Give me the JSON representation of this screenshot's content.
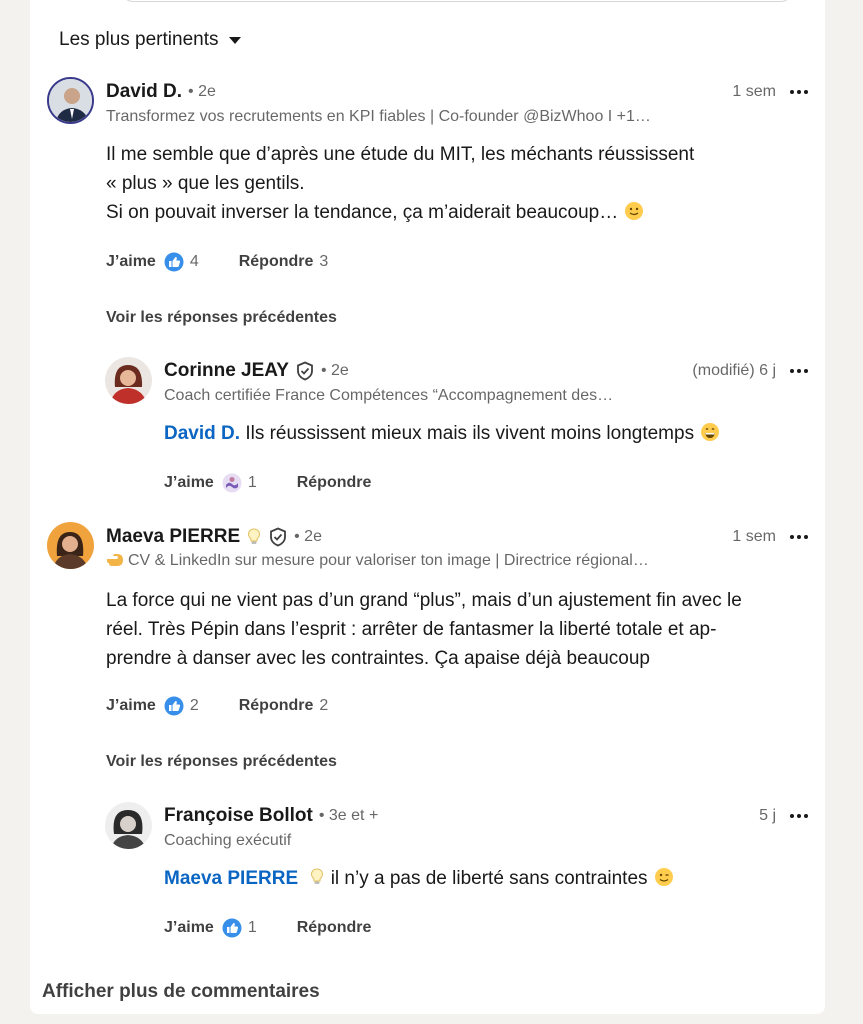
{
  "sort": {
    "label": "Les plus pertinents"
  },
  "comments": [
    {
      "name": "David D.",
      "degree": "• 2e",
      "headline": "Transformez vos recrutements en KPI fiables | Co-founder @BizWhoo I +1…",
      "time": "1 sem",
      "lines": [
        "Il me semble que d’après une étude du MIT, les méchants réussissent",
        "« plus » que les gentils.",
        "Si on pouvait inverser la tendance, ça m’aiderait beaucoup…"
      ],
      "like_label": "J’aime",
      "like_count": "4",
      "reply_label": "Répondre",
      "reply_count": "3",
      "prev_replies": "Voir les réponses précédentes"
    },
    {
      "name": "Corinne JEAY",
      "degree": "• 2e",
      "headline": "Coach certifiée France Compétences “Accompagnement des…",
      "time": "(modifié) 6 j",
      "mention": "David D.",
      "text": "Ils réussissent mieux mais ils vivent moins longtemps",
      "like_label": "J’aime",
      "like_count": "1",
      "reply_label": "Répondre"
    },
    {
      "name": "Maeva PIERRE",
      "degree": "• 2e",
      "headline": "CV & LinkedIn sur mesure pour valoriser ton image | Directrice régional…",
      "time": "1 sem",
      "lines": [
        "La force qui ne vient pas d’un grand “plus”, mais d’un ajustement fin avec le",
        "réel. Très Pépin dans l’esprit : arrêter de fantasmer la liberté totale et ap-",
        "prendre à danser avec les contraintes. Ça apaise déjà beaucoup"
      ],
      "like_label": "J’aime",
      "like_count": "2",
      "reply_label": "Répondre",
      "reply_count": "2",
      "prev_replies": "Voir les réponses précédentes"
    },
    {
      "name": "Françoise Bollot",
      "degree": "• 3e et +",
      "headline": "Coaching exécutif",
      "time": "5 j",
      "mention": "Maeva PIERRE",
      "text": "il n’y a pas de liberté sans contraintes",
      "like_label": "J’aime",
      "like_count": "1",
      "reply_label": "Répondre"
    }
  ],
  "more_comments": "Afficher plus de commentaires",
  "colors": {
    "link": "#0a66c2",
    "like": "#378fe9",
    "background": "#f4f2ee"
  }
}
